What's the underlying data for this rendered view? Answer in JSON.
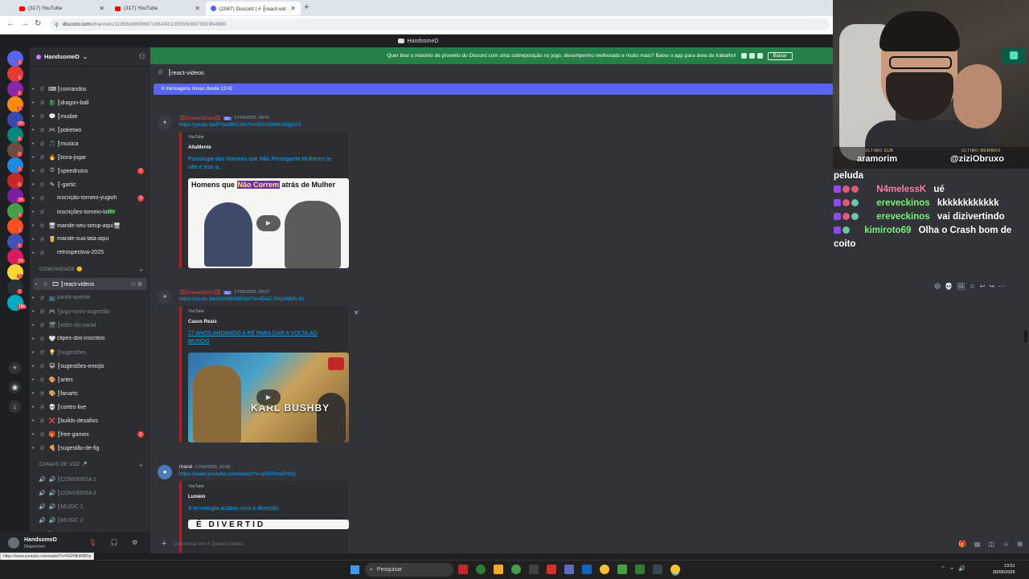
{
  "browser": {
    "tabs": [
      {
        "title": "(317) YouTube",
        "kind": "youtube"
      },
      {
        "title": "(317) YouTube",
        "kind": "youtube"
      },
      {
        "title": "(2047) Discord | # ┇react-vid",
        "kind": "discord",
        "active": true
      }
    ],
    "url_host": "discord.com",
    "url_path": "/channels/1135608809667166240/1305550887992954980"
  },
  "discord": {
    "window_title": "HandsomeD",
    "server_name": "HandsomeD",
    "server_badges": [
      "1",
      "1",
      "1",
      "1",
      "60",
      "1",
      "1",
      "1",
      "1",
      "10",
      "4",
      "1",
      "1",
      "50",
      "1",
      "1",
      "18k"
    ],
    "channels": [
      {
        "emoji": "⌨",
        "name": "┇comandos",
        "muted": false
      },
      {
        "emoji": "🐉",
        "name": "┇dragon-ball",
        "muted": false
      },
      {
        "emoji": "💬",
        "name": "┇mudae",
        "muted": false
      },
      {
        "emoji": "🎮",
        "name": "┇poketwo",
        "muted": false
      },
      {
        "emoji": "🎵",
        "name": "┇musica",
        "muted": false
      },
      {
        "emoji": "🔥",
        "name": "┇bora-jogar",
        "muted": false
      },
      {
        "emoji": "⏱",
        "name": "┇speedruins",
        "muted": false,
        "badge": "1"
      },
      {
        "emoji": "✎",
        "name": "┇-gartic",
        "muted": false
      },
      {
        "emoji": "",
        "name": "inscrição-torneio-yugioh",
        "muted": false,
        "badge": "3"
      },
      {
        "emoji": "",
        "name": "inscrições-torneio-lol🇧🇷",
        "muted": false
      },
      {
        "emoji": "🖥",
        "name": "mande-seu-setup-aqui🖥",
        "muted": false
      },
      {
        "emoji": "🥫",
        "name": "mande-sua-lata-aqui",
        "muted": false
      },
      {
        "emoji": "",
        "name": "retrospectiva-2025",
        "muted": false
      }
    ],
    "category_comunidade": "COMUNIDADE 🙂",
    "channels_comunidade": [
      {
        "emoji": "🎞",
        "name": "┇react-videos",
        "muted": false,
        "selected": true
      },
      {
        "emoji": "📺",
        "name": "pauta-quente",
        "muted": true
      },
      {
        "emoji": "🎮",
        "name": "┇jogo-novo-sugestão",
        "muted": true
      },
      {
        "emoji": "🎬",
        "name": "┇edits-do-canal",
        "muted": true
      },
      {
        "emoji": "🤍",
        "name": "clipes-dos-inscritos",
        "muted": false
      },
      {
        "emoji": "💡",
        "name": "┇sugestões",
        "muted": true
      },
      {
        "emoji": "😺",
        "name": "┇sugestões-emojis",
        "muted": false
      },
      {
        "emoji": "🎨",
        "name": "┇artes",
        "muted": false
      },
      {
        "emoji": "🎨",
        "name": "┇fanarts",
        "muted": false
      },
      {
        "emoji": "💀",
        "name": "┇cortes-live",
        "muted": false
      },
      {
        "emoji": "❌",
        "name": "┇builds-desafios",
        "muted": false
      },
      {
        "emoji": "🎁",
        "name": "┇free-games",
        "muted": false,
        "badge": "1"
      },
      {
        "emoji": "🍕",
        "name": "┇sugestão-de-fig",
        "muted": false
      }
    ],
    "category_voz": "CANAIS DE VOZ 🎤",
    "voice_channels": [
      "┇CONVERSA 1",
      "┇CONVERSA 2",
      "┇MUSIC 1",
      "┇MUSIC 2"
    ],
    "voice_partial": "Canal das jogatinas loucas",
    "user": {
      "name": "HandsomeD",
      "status": "Disponível"
    },
    "status_link": "https://www.youtube.com/watch?v=5GH9kWt8Op",
    "banner_text": "Quer tirar o máximo de proveito do Discord com uma sobreposição no jogo, desempenho melhorado e muito mais? Baixe o app para área de trabalho!",
    "banner_button": "Baixar",
    "channel_title": "┇react-videos",
    "new_messages": "6 mensagens novas desde 13:42",
    "messages": [
      {
        "author": "💢Ereveckinos💢",
        "tag": "DC",
        "time": "17/06/2026, 06:41",
        "link": "https://youtu.be/PYav9KiCHls?si=9OVDMt6ciRrjj1A3",
        "provider": "YouTube",
        "channel": "AltaMente",
        "title": "Psicologia dos Homens que Não Perseguem Mulheres (e não é isso q...",
        "thumb_caption_a": "Homens que ",
        "thumb_caption_hl": "Não Correm",
        "thumb_caption_b": " atrás de Mulher"
      },
      {
        "author": "💢Ereveckinos💢",
        "tag": "DC",
        "time": "17/06/2026, 09:07",
        "link": "https://youtu.be/5GH9kWt8Op!?si=IDaZ-SVp1Mdfx-6c",
        "provider": "YouTube",
        "channel": "Casos Reais",
        "title": "27 ANOS ANDANDO A PÉ PARA DAR A VOLTA AO MUNDO",
        "thumb_text": "KARL BUSHBY"
      },
      {
        "author": "mané",
        "tag": "",
        "time": "17/06/2026, 10:43",
        "link": "https://www.youtube.com/watch?v=qi5KPnm5HzQ",
        "provider": "YouTube",
        "channel": "Lumém",
        "title": "A tecnologia acabou com a diversão",
        "thumb_text": "É DIVERTID"
      }
    ],
    "composer_placeholder": "Conversar em # ┇react-videos"
  },
  "stream": {
    "last_sub_label": "ULTIMO SUB",
    "last_sub": "aramorim",
    "last_member_label": "ULTIMO MEMBRO",
    "last_member": "@ziziObruxo",
    "chat": [
      {
        "user": "",
        "text": "peluda",
        "color": "#ffffff"
      },
      {
        "user": "N4melessK",
        "text": "ué",
        "color": "#ff7aa8"
      },
      {
        "user": "ereveckinos",
        "text": "kkkkkkkkkkkk",
        "color": "#7cf07a"
      },
      {
        "user": "ereveckinos",
        "text": "vai dizivertindo",
        "color": "#7cf07a"
      },
      {
        "user": "kimiroto69",
        "text": "Olha o Crash bom de",
        "color": "#7cf07a"
      },
      {
        "user": "",
        "text": "coito",
        "color": "#ffffff"
      }
    ]
  },
  "taskbar": {
    "search": "Pesquisar",
    "time": "13:51",
    "date": "20/06/2026"
  }
}
